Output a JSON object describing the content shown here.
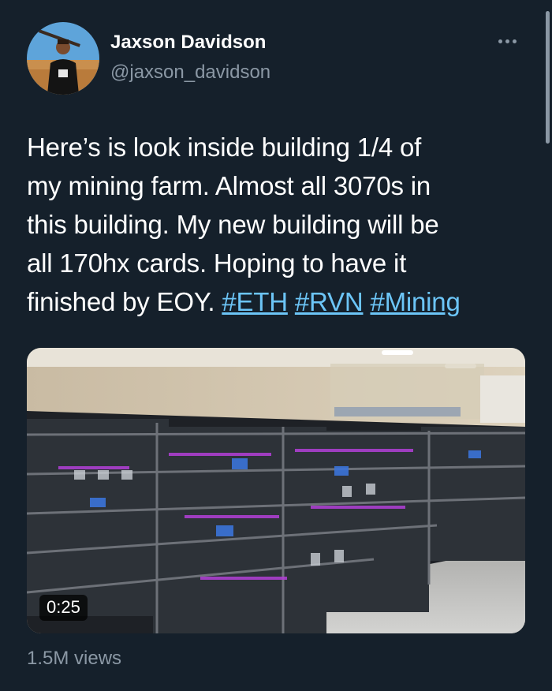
{
  "author": {
    "name": "Jaxson Davidson",
    "handle": "@jaxson_davidson"
  },
  "tweet": {
    "text_lines": [
      "Here’s is look inside building 1/4 of",
      "my mining farm. Almost all 3070s in",
      "this building. My new building will be",
      "all 170hx cards. Hoping to have it",
      "finished by EOY. "
    ],
    "hashtags": [
      "#ETH",
      "#RVN",
      "#Mining"
    ]
  },
  "media": {
    "type": "video",
    "duration": "0:25"
  },
  "views_label": "1.5M views",
  "colors": {
    "background": "#15202b",
    "text": "#ffffff",
    "muted": "#8b98a5",
    "link": "#6cc5f7"
  },
  "icons": {
    "more": "more-horizontal-icon"
  }
}
